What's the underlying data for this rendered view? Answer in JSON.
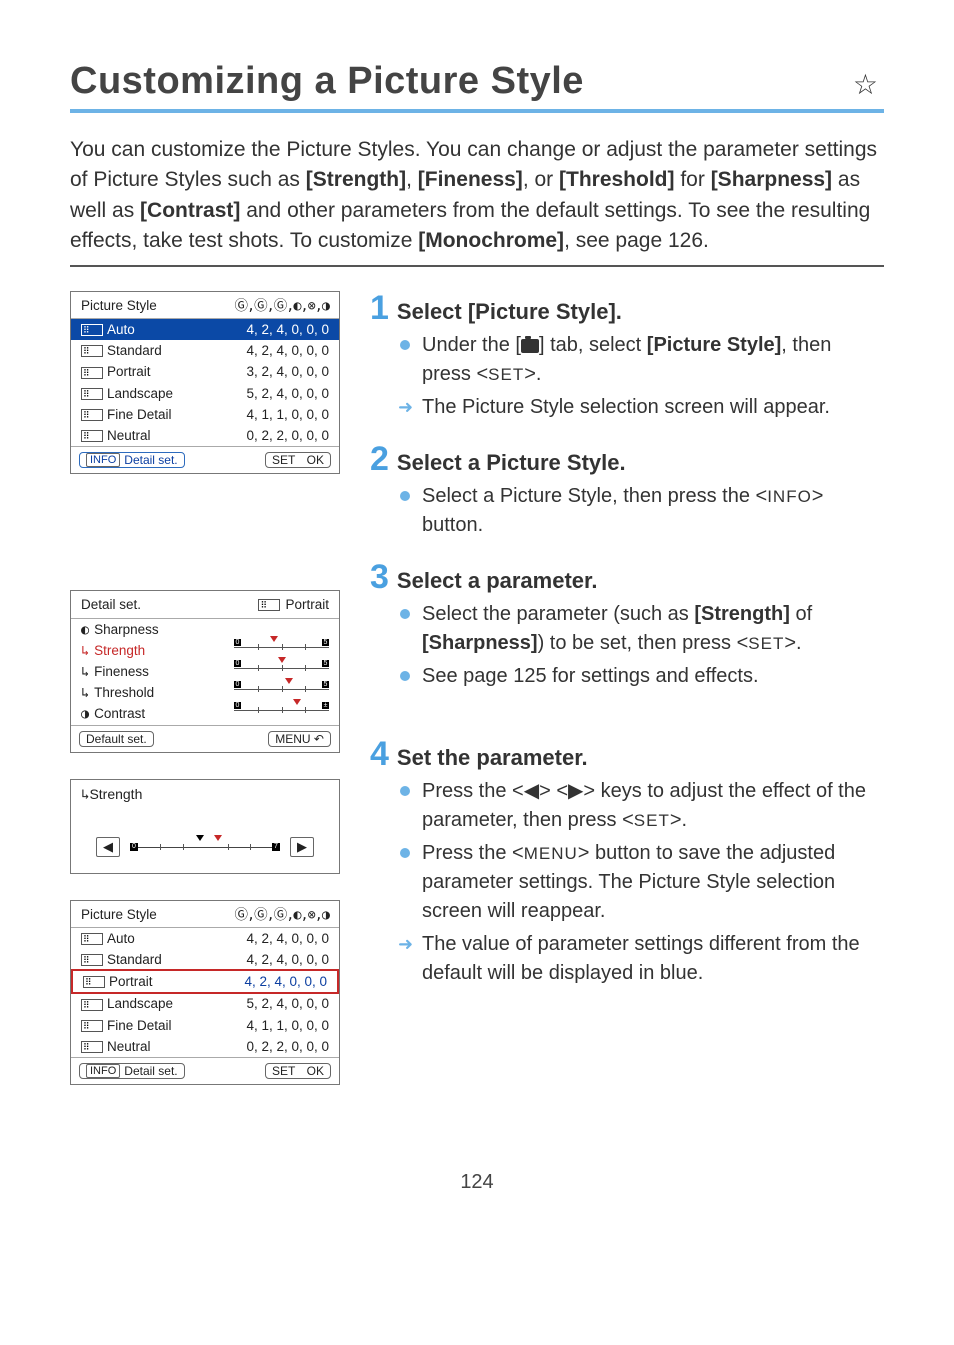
{
  "page": {
    "title": "Customizing a Picture Style",
    "number": "124"
  },
  "intro": {
    "p1a": "You can customize the Picture Styles. You can change or adjust the parameter settings of Picture Styles such as ",
    "b1": "[Strength]",
    "c1": ", ",
    "b2": "[Fineness]",
    "c2": ", or ",
    "b3": "[Threshold]",
    "c3": " for ",
    "b4": "[Sharpness]",
    "c4": " as well as ",
    "b5": "[Contrast]",
    "c5": " and other parameters from the default settings. To see the resulting effects, take test shots. To customize ",
    "b6": "[Monochrome]",
    "c6": ", see page 126."
  },
  "panel1": {
    "header_left": "Picture Style",
    "styles": [
      {
        "label": "Auto",
        "vals": "4, 2, 4, 0, 0, 0",
        "sel": true
      },
      {
        "label": "Standard",
        "vals": "4, 2, 4, 0, 0, 0"
      },
      {
        "label": "Portrait",
        "vals": "3, 2, 4, 0, 0, 0"
      },
      {
        "label": "Landscape",
        "vals": "5, 2, 4, 0, 0, 0"
      },
      {
        "label": "Fine Detail",
        "vals": "4, 1, 1, 0, 0, 0"
      },
      {
        "label": "Neutral",
        "vals": "0, 2, 2, 0, 0, 0"
      }
    ],
    "foot_info": "INFO",
    "foot_detail": "Detail set.",
    "foot_set": "SET",
    "foot_ok": "OK"
  },
  "detailPanel": {
    "header_left": "Detail set.",
    "header_right": "Portrait",
    "rows": [
      {
        "icon": "◐",
        "label": "Sharpness"
      },
      {
        "icon": "↳",
        "label": "Strength",
        "selred": true
      },
      {
        "icon": "↳",
        "label": "Fineness"
      },
      {
        "icon": "↳",
        "label": "Threshold"
      },
      {
        "icon": "◑",
        "label": "Contrast"
      }
    ],
    "foot_left": "Default set.",
    "foot_right": "MENU ↶"
  },
  "strengthPanel": {
    "title_icon": "↳",
    "title": "Strength"
  },
  "panel2": {
    "header_left": "Picture Style",
    "styles": [
      {
        "label": "Auto",
        "vals": "4, 2, 4, 0, 0, 0"
      },
      {
        "label": "Standard",
        "vals": "4, 2, 4, 0, 0, 0"
      },
      {
        "label": "Portrait",
        "vals": "4, 2, 4, 0, 0, 0",
        "selred_border": true,
        "blueval": true
      },
      {
        "label": "Landscape",
        "vals": "5, 2, 4, 0, 0, 0"
      },
      {
        "label": "Fine Detail",
        "vals": "4, 1, 1, 0, 0, 0"
      },
      {
        "label": "Neutral",
        "vals": "0, 2, 2, 0, 0, 0"
      }
    ],
    "foot_info": "INFO",
    "foot_detail": "Detail set.",
    "foot_set": "SET",
    "foot_ok": "OK"
  },
  "steps": {
    "s1": {
      "num": "1",
      "title": "Select [Picture Style].",
      "b1a": "Under the [",
      "b1c": "] tab, select ",
      "b1d": "[Picture Style]",
      "b1e": ", then press <",
      "b1f": "SET",
      "b1g": ">.",
      "b2": "The Picture Style selection screen will appear."
    },
    "s2": {
      "num": "2",
      "title": "Select a Picture Style.",
      "b1a": "Select a Picture Style, then press the <",
      "b1b": "INFO",
      "b1c": "> button."
    },
    "s3": {
      "num": "3",
      "title": "Select a parameter.",
      "b1a": "Select the parameter (such as ",
      "b1b": "[Strength]",
      "b1c": " of ",
      "b1d": "[Sharpness]",
      "b1e": ") to be set, then press <",
      "b1f": "SET",
      "b1g": ">.",
      "b2": "See page 125 for settings and effects."
    },
    "s4": {
      "num": "4",
      "title": "Set the parameter.",
      "b1a": "Press the <◀> <▶> keys to adjust the effect of the parameter, then press <",
      "b1b": "SET",
      "b1c": ">.",
      "b2a": "Press the <",
      "b2b": "MENU",
      "b2c": "> button to save the adjusted parameter settings. The Picture Style selection screen will reappear.",
      "b3": "The value of parameter settings different from the default will be displayed in blue."
    }
  }
}
